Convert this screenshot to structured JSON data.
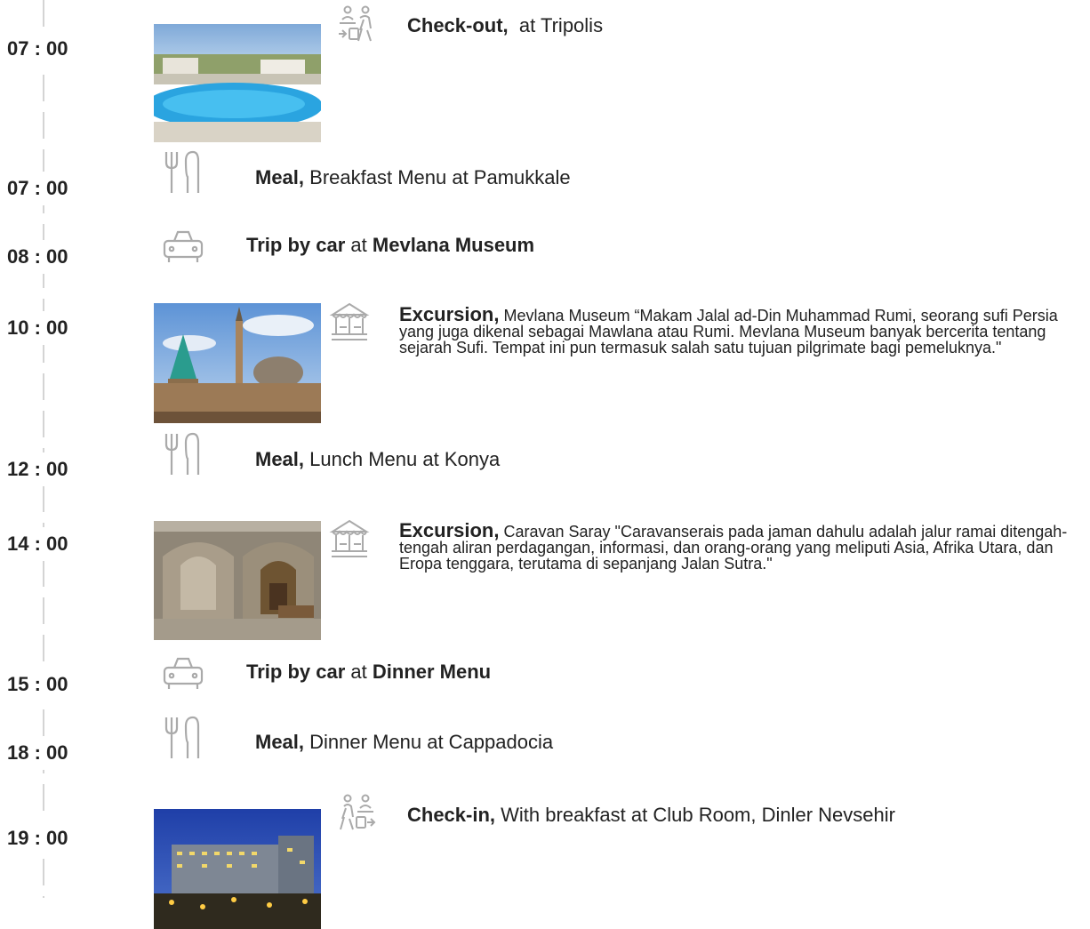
{
  "items": [
    {
      "time": "07 : 00",
      "bold": "Check-out,",
      "text": "at Tripolis",
      "icon": "check-out-icon",
      "image": "pool-photo"
    },
    {
      "time": "07 : 00",
      "bold": "Meal,",
      "text": "Breakfast Menu at Pamukkale",
      "icon": "meal-icon"
    },
    {
      "time": "08 : 00",
      "bold": "Trip by car",
      "mid": "at",
      "bold2": "Mevlana Museum",
      "icon": "car-icon"
    },
    {
      "time": "10 : 00",
      "bold": "Excursion,",
      "text": "Mevlana Museum “Makam Jalal ad-Din Muhammad Rumi, seorang sufi Persia yang juga dikenal sebagai Mawlana atau Rumi. Mevlana Museum banyak bercerita tentang sejarah Sufi. Tempat ini pun termasuk salah satu tujuan pilgrimate bagi pemeluknya.\"",
      "icon": "carousel-icon",
      "image": "mosque-photo"
    },
    {
      "time": "12 : 00",
      "bold": "Meal,",
      "text": "Lunch Menu at Konya",
      "icon": "meal-icon"
    },
    {
      "time": "14 : 00",
      "bold": "Excursion,",
      "text": "Caravan Saray \"Caravanserais pada jaman dahulu adalah jalur ramai ditengah-tengah aliran perdagangan, informasi, dan orang-orang yang meliputi Asia, Afrika Utara, dan Eropa tenggara, terutama di sepanjang Jalan Sutra.\"",
      "icon": "carousel-icon",
      "image": "caravanserai-photo"
    },
    {
      "time": "15 : 00",
      "bold": "Trip by car",
      "mid": "at",
      "bold2": "Dinner Menu",
      "icon": "car-icon"
    },
    {
      "time": "18 : 00",
      "bold": "Meal,",
      "text": "Dinner Menu at Cappadocia",
      "icon": "meal-icon"
    },
    {
      "time": "19 : 00",
      "bold": "Check-in,",
      "text": "With breakfast at Club Room, Dinler Nevsehir",
      "icon": "check-in-icon",
      "image": "hotel-photo"
    }
  ]
}
